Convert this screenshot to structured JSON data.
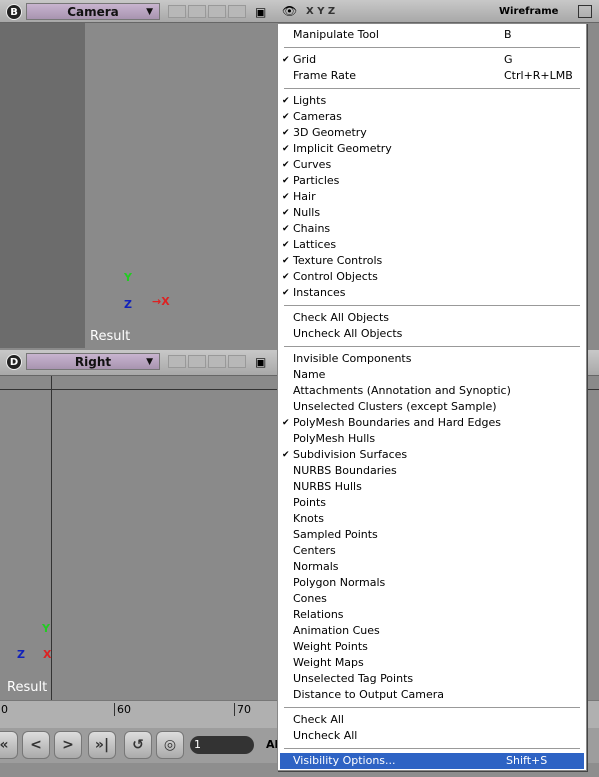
{
  "viewport_top": {
    "badge": "B",
    "view": "Camera",
    "display_mode": "Wireframe",
    "axes": "X Y Z",
    "result": "Result"
  },
  "viewport_bottom": {
    "badge": "D",
    "view": "Right",
    "result": "Result"
  },
  "timeline": {
    "ticks": [
      "0",
      "60",
      "70"
    ]
  },
  "playback": {
    "frame": "1",
    "all_label": "Al"
  },
  "menu": {
    "groups": [
      [
        {
          "label": "Manipulate Tool",
          "shortcut": "B",
          "checked": false
        }
      ],
      [
        {
          "label": "Grid",
          "shortcut": "G",
          "checked": true
        },
        {
          "label": "Frame Rate",
          "shortcut": "Ctrl+R+LMB",
          "checked": false
        }
      ],
      [
        {
          "label": "Lights",
          "checked": true
        },
        {
          "label": "Cameras",
          "checked": true
        },
        {
          "label": "3D Geometry",
          "checked": true
        },
        {
          "label": "Implicit Geometry",
          "checked": true
        },
        {
          "label": "Curves",
          "checked": true
        },
        {
          "label": "Particles",
          "checked": true
        },
        {
          "label": "Hair",
          "checked": true
        },
        {
          "label": "Nulls",
          "checked": true
        },
        {
          "label": "Chains",
          "checked": true
        },
        {
          "label": "Lattices",
          "checked": true
        },
        {
          "label": "Texture Controls",
          "checked": true
        },
        {
          "label": "Control Objects",
          "checked": true
        },
        {
          "label": "Instances",
          "checked": true
        }
      ],
      [
        {
          "label": "Check All Objects",
          "checked": false
        },
        {
          "label": "Uncheck All Objects",
          "checked": false
        }
      ],
      [
        {
          "label": "Invisible Components",
          "checked": false
        },
        {
          "label": "Name",
          "checked": false
        },
        {
          "label": "Attachments (Annotation and Synoptic)",
          "checked": false
        },
        {
          "label": "Unselected Clusters (except Sample)",
          "checked": false
        },
        {
          "label": "PolyMesh Boundaries and Hard Edges",
          "checked": true
        },
        {
          "label": "PolyMesh Hulls",
          "checked": false
        },
        {
          "label": "Subdivision Surfaces",
          "checked": true
        },
        {
          "label": "NURBS Boundaries",
          "checked": false
        },
        {
          "label": "NURBS Hulls",
          "checked": false
        },
        {
          "label": "Points",
          "checked": false
        },
        {
          "label": "Knots",
          "checked": false
        },
        {
          "label": "Sampled Points",
          "checked": false
        },
        {
          "label": "Centers",
          "checked": false
        },
        {
          "label": "Normals",
          "checked": false
        },
        {
          "label": "Polygon Normals",
          "checked": false
        },
        {
          "label": "Cones",
          "checked": false
        },
        {
          "label": "Relations",
          "checked": false
        },
        {
          "label": "Animation Cues",
          "checked": false
        },
        {
          "label": "Weight Points",
          "checked": false
        },
        {
          "label": "Weight Maps",
          "checked": false
        },
        {
          "label": "Unselected Tag Points",
          "checked": false
        },
        {
          "label": "Distance to Output Camera",
          "checked": false
        }
      ],
      [
        {
          "label": "Check All",
          "checked": false
        },
        {
          "label": "Uncheck All",
          "checked": false
        }
      ],
      [
        {
          "label": "Visibility Options...",
          "shortcut": "Shift+S",
          "checked": false,
          "highlighted": true
        }
      ]
    ]
  }
}
